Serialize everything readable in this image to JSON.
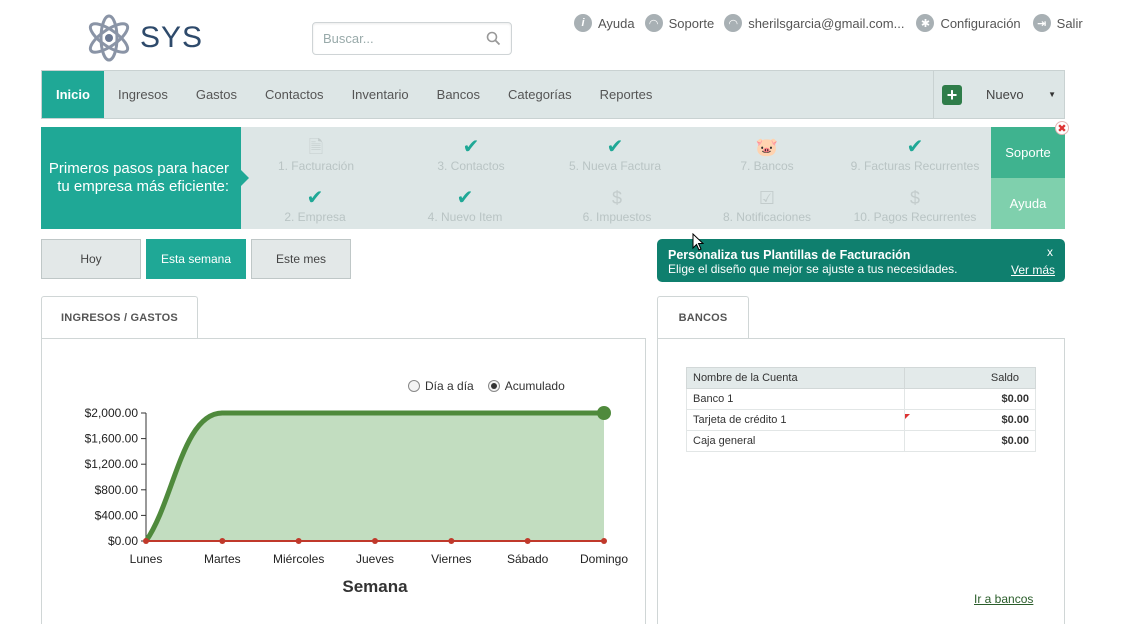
{
  "header": {
    "logo_text": "SYS",
    "search_placeholder": "Buscar...",
    "links": [
      {
        "label": "Ayuda",
        "icon": "info-icon"
      },
      {
        "label": "Soporte",
        "icon": "support-icon"
      },
      {
        "label": "sherilsgarcia@gmail.com...",
        "icon": "user-icon"
      },
      {
        "label": "Configuración",
        "icon": "gear-icon"
      },
      {
        "label": "Salir",
        "icon": "logout-icon"
      }
    ]
  },
  "nav": {
    "items": [
      "Inicio",
      "Ingresos",
      "Gastos",
      "Contactos",
      "Inventario",
      "Bancos",
      "Categorías",
      "Reportes"
    ],
    "active": "Inicio",
    "new_label": "Nuevo"
  },
  "onboarding": {
    "title": "Primeros pasos para hacer tu empresa más eficiente:",
    "steps": [
      {
        "label": "1. Facturación",
        "done": false
      },
      {
        "label": "3. Contactos",
        "done": true
      },
      {
        "label": "5. Nueva Factura",
        "done": true
      },
      {
        "label": "7. Bancos",
        "done": false
      },
      {
        "label": "9. Facturas Recurrentes",
        "done": true
      },
      {
        "label": "2. Empresa",
        "done": true
      },
      {
        "label": "4. Nuevo Item",
        "done": true
      },
      {
        "label": "6. Impuestos",
        "done": false
      },
      {
        "label": "8. Notificaciones",
        "done": false
      },
      {
        "label": "10. Pagos Recurrentes",
        "done": false
      }
    ],
    "support_label": "Soporte",
    "help_label": "Ayuda"
  },
  "period": {
    "buttons": [
      "Hoy",
      "Esta semana",
      "Este mes"
    ],
    "active": "Esta semana"
  },
  "promo": {
    "title": "Personaliza tus Plantillas de Facturación",
    "subtitle": "Elige el diseño que mejor se ajuste a tus necesidades.",
    "link": "Ver más",
    "close": "x"
  },
  "income_panel": {
    "tab": "INGRESOS / GASTOS",
    "mode_options": [
      "Día a día",
      "Acumulado"
    ],
    "mode_selected": "Acumulado"
  },
  "chart_data": {
    "type": "area",
    "xlabel": "Semana",
    "ylabel": "",
    "categories": [
      "Lunes",
      "Martes",
      "Miércoles",
      "Jueves",
      "Viernes",
      "Sábado",
      "Domingo"
    ],
    "ylim": [
      0,
      2000
    ],
    "yticks": [
      "$0.00",
      "$400.00",
      "$800.00",
      "$1,200.00",
      "$1,600.00",
      "$2,000.00"
    ],
    "series": [
      {
        "values": [
          0,
          2000,
          2000,
          2000,
          2000,
          2000,
          2000
        ],
        "color": "#4f8a3c",
        "fill": "#c2ddc0"
      },
      {
        "values": [
          0,
          0,
          0,
          0,
          0,
          0,
          0
        ],
        "color": "#c0392b"
      }
    ]
  },
  "banks_panel": {
    "tab": "BANCOS",
    "columns": [
      "Nombre de la Cuenta",
      "Saldo"
    ],
    "rows": [
      {
        "name": "Banco 1",
        "balance": "$0.00"
      },
      {
        "name": "Tarjeta de crédito 1",
        "balance": "$0.00"
      },
      {
        "name": "Caja general",
        "balance": "$0.00"
      }
    ],
    "link": "Ir a bancos"
  },
  "colors": {
    "accent": "#1fa896",
    "dark_teal": "#0f7f6e",
    "nav_bg": "#dde6e6"
  }
}
